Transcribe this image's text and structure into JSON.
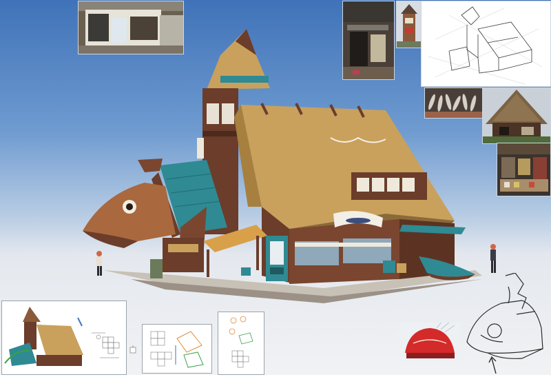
{
  "canvas": {
    "colors": {
      "sky_top": "#3f72b8",
      "sky_bottom": "#f1f2f4",
      "thatch": "#c9a15c",
      "wood": "#6b3d2a",
      "teal": "#2f8a93"
    }
  },
  "main_illustration": {
    "banner_texts": [],
    "subject": "thatched-roof-shop-with-fish-facade"
  },
  "reference_photos": [
    {
      "name": "shopfront-with-vending-machine"
    },
    {
      "name": "shop-with-noren-curtain"
    },
    {
      "name": "small-tower"
    },
    {
      "name": "isometric-line-sketch"
    },
    {
      "name": "dried-fish-display"
    },
    {
      "name": "thatched-farmhouse"
    },
    {
      "name": "shop-interior-stall"
    },
    {
      "name": "red-fish-building-photo"
    }
  ],
  "bottom_panels": {
    "panel1_labels": [],
    "panel2_labels": [],
    "panel3_labels": [],
    "arrow_note": ""
  }
}
